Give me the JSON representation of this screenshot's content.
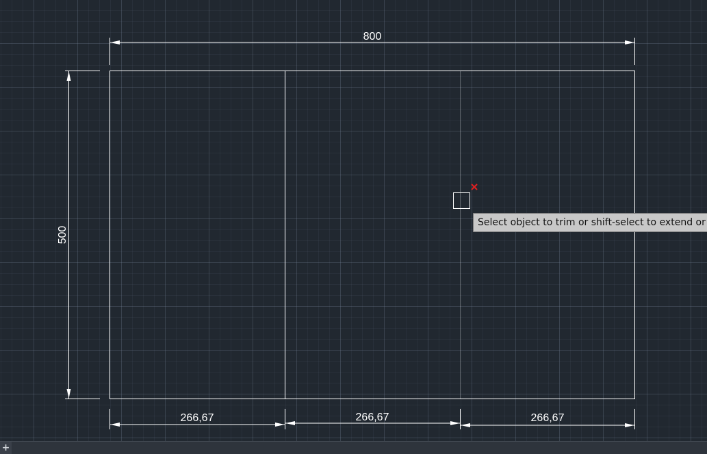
{
  "drawing": {
    "width_dimension": "800",
    "height_dimension": "500",
    "bottom_dimensions": [
      "266,67",
      "266,67",
      "266,67"
    ]
  },
  "tooltip": {
    "text": "Select object to trim or shift-select to extend or"
  },
  "statusbar": {
    "add_tab_symbol": "+"
  },
  "colors": {
    "background": "#212830",
    "lines": "#ffffff",
    "cursor_marker": "#e02020",
    "tooltip_bg": "#c8c8c8"
  },
  "icons": {
    "cursor_marker": "x-icon",
    "pickbox": "square-pickbox-icon"
  }
}
